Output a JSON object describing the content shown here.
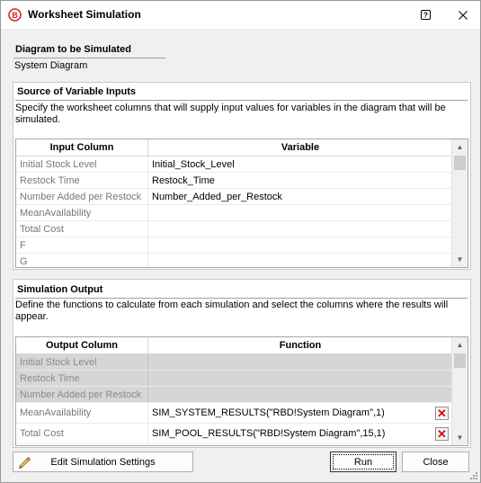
{
  "window": {
    "title": "Worksheet Simulation",
    "help_icon": "question-mark-icon",
    "close_icon": "close-icon",
    "app_icon": "app-logo-icon"
  },
  "diagram": {
    "heading": "Diagram to be Simulated",
    "value": "System Diagram"
  },
  "inputs": {
    "heading": "Source of Variable Inputs",
    "description": "Specify the worksheet columns that will supply input values for variables in the diagram that will be simulated.",
    "col_input": "Input Column",
    "col_variable": "Variable",
    "rows": [
      {
        "column": "Initial Stock Level",
        "variable": "Initial_Stock_Level"
      },
      {
        "column": "Restock Time",
        "variable": "Restock_Time"
      },
      {
        "column": "Number Added per Restock",
        "variable": "Number_Added_per_Restock"
      },
      {
        "column": "MeanAvailability",
        "variable": ""
      },
      {
        "column": "Total Cost",
        "variable": ""
      },
      {
        "column": "F",
        "variable": ""
      },
      {
        "column": "G",
        "variable": ""
      }
    ]
  },
  "output": {
    "heading": "Simulation Output",
    "description": "Define the functions to calculate from each simulation and select the columns where the results will appear.",
    "col_output": "Output Column",
    "col_function": "Function",
    "rows": [
      {
        "column": "Initial Stock Level",
        "function": ""
      },
      {
        "column": "Restock Time",
        "function": ""
      },
      {
        "column": "Number Added per Restock",
        "function": ""
      },
      {
        "column": "MeanAvailability",
        "function": "SIM_SYSTEM_RESULTS(\"RBD!System Diagram\",1)"
      },
      {
        "column": "Total Cost",
        "function": "SIM_POOL_RESULTS(\"RBD!System Diagram\",15,1)"
      }
    ]
  },
  "buttons": {
    "edit_settings": "Edit Simulation Settings",
    "run": "Run",
    "close": "Close"
  },
  "colors": {
    "delete_icon": "#d20f0f",
    "disabled_row": "#d6d6d6"
  }
}
